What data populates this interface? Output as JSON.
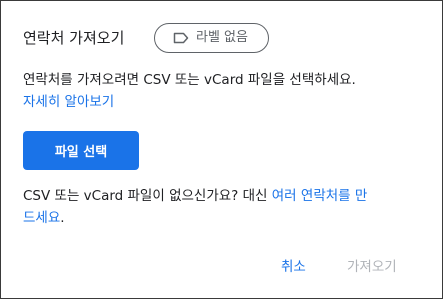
{
  "dialog": {
    "title": "연락처 가져오기",
    "label_chip": {
      "icon": "label-outline-icon",
      "text": "라벨 없음"
    },
    "description": {
      "text": "연락처를 가져오려면 CSV 또는 vCard 파일을 선택하세요.",
      "learn_more_link": "자세히 알아보기"
    },
    "select_file_button": "파일 선택",
    "no_file_note": {
      "text_before_link": "CSV 또는 vCard 파일이 없으신가요? 대신 ",
      "link_part1": "여러 연락처를 만",
      "link_part2": "드세요",
      "text_after_link": "."
    },
    "actions": {
      "cancel_label": "취소",
      "import_label": "가져오기",
      "import_disabled": true
    }
  },
  "colors": {
    "accent": "#1a73e8",
    "text_primary": "#202124",
    "text_secondary": "#5f6368",
    "disabled_text": "#b0b3b8"
  }
}
